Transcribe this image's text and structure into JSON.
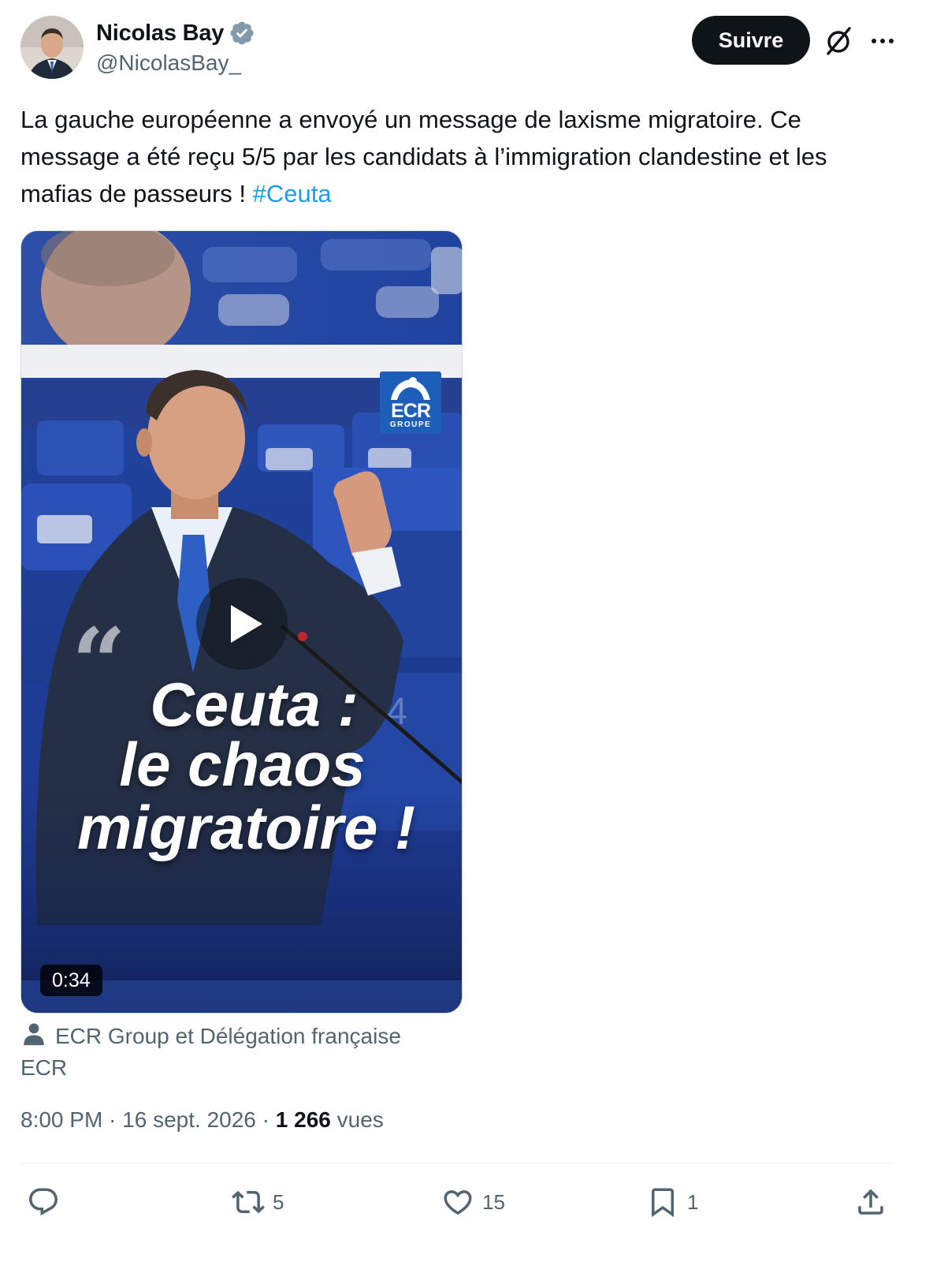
{
  "author": {
    "display_name": "Nicolas Bay",
    "handle": "@NicolasBay_",
    "verified_icon": "verified-badge-icon"
  },
  "header": {
    "follow_label": "Suivre"
  },
  "tweet": {
    "text": "La gauche européenne a envoyé un message de laxisme migratoire. Ce message a été reçu 5/5 par les candidats à l’immigration clandestine et les mafias de passeurs ! ",
    "hashtag": "#Ceuta"
  },
  "media": {
    "logo_main": "ECR",
    "logo_sub": "GROUPE",
    "quote_mark": "“",
    "headline_line1": "Ceuta :",
    "headline_line2": "le chaos",
    "headline_line3": "migratoire !",
    "duration": "0:34"
  },
  "attribution": {
    "line1": "ECR Group et Délégation française",
    "line2": "ECR"
  },
  "meta": {
    "time": "8:00 PM",
    "separator": " · ",
    "date": "16 sept. 2026",
    "views_count": "1 266",
    "views_label": " vues"
  },
  "actions": {
    "reply_count": "",
    "retweet_count": "5",
    "like_count": "15",
    "bookmark_count": "1"
  },
  "colors": {
    "accent": "#1d9bf0",
    "text": "#0f1419",
    "secondary": "#536471",
    "follow_bg": "#0f1419"
  }
}
